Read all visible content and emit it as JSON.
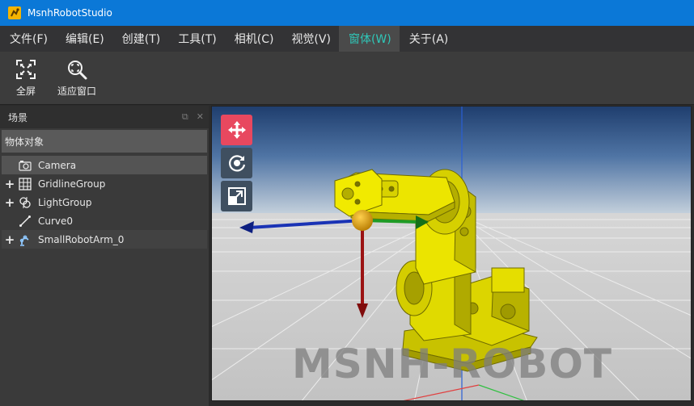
{
  "window": {
    "title": "MsnhRobotStudio"
  },
  "menu": [
    {
      "label": "文件(F)",
      "active": false
    },
    {
      "label": "编辑(E)",
      "active": false
    },
    {
      "label": "创建(T)",
      "active": false
    },
    {
      "label": "工具(T)",
      "active": false
    },
    {
      "label": "相机(C)",
      "active": false
    },
    {
      "label": "视觉(V)",
      "active": false
    },
    {
      "label": "窗体(W)",
      "active": true
    },
    {
      "label": "关于(A)",
      "active": false
    }
  ],
  "toolbar": {
    "fullscreen": {
      "label": "全屏",
      "icon": "fullscreen-icon"
    },
    "fit_window": {
      "label": "适应窗口",
      "icon": "zoom-fit-icon"
    }
  },
  "scene_panel": {
    "title": "场景",
    "tree_header": "物体对象",
    "items": [
      {
        "label": "Camera",
        "icon": "camera-icon",
        "expandable": false,
        "state": "selected"
      },
      {
        "label": "GridlineGroup",
        "icon": "grid-icon",
        "expandable": true,
        "state": ""
      },
      {
        "label": "LightGroup",
        "icon": "light-icon",
        "expandable": true,
        "state": ""
      },
      {
        "label": "Curve0",
        "icon": "curve-icon",
        "expandable": false,
        "state": ""
      },
      {
        "label": "SmallRobotArm_0",
        "icon": "robot-arm-icon",
        "expandable": true,
        "state": "hover"
      }
    ]
  },
  "viewport": {
    "tools": [
      {
        "name": "move-tool",
        "icon": "move-arrows-icon",
        "active": true
      },
      {
        "name": "rotate-tool",
        "icon": "rotate-icon",
        "active": false
      },
      {
        "name": "scale-tool",
        "icon": "scale-icon",
        "active": false
      }
    ],
    "watermark": "MSNH-ROBOT"
  },
  "colors": {
    "titlebar": "#0b78d7",
    "menu_active_text": "#2fc7b8",
    "gizmo_active": "#e8485f",
    "robot_yellow": "#e8e000"
  }
}
